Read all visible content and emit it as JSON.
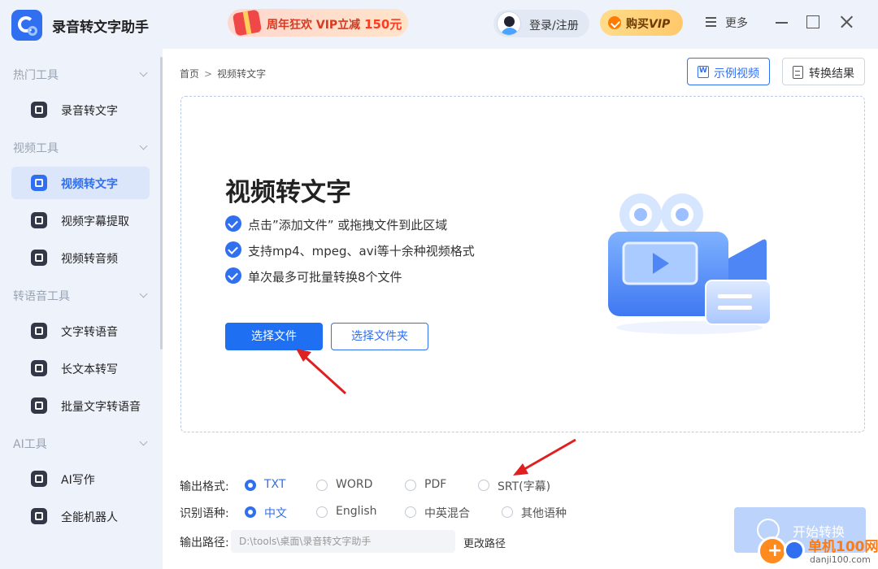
{
  "titlebar": {
    "app_name": "录音转文字助手",
    "promo_text": "周年狂欢 VIP立减 ",
    "promo_amount": "150元",
    "login_label": "登录/注册",
    "vip_prefix": "购买",
    "vip_suffix": "VIP",
    "more_label": "更多"
  },
  "sidebar": {
    "sections": [
      {
        "title": "热门工具",
        "items": [
          {
            "label": "录音转文字",
            "icon": "text-t-icon"
          }
        ]
      },
      {
        "title": "视频工具",
        "items": [
          {
            "label": "视频转文字",
            "icon": "video-text-icon",
            "active": true
          },
          {
            "label": "视频字幕提取",
            "icon": "subtitle-extract-icon"
          },
          {
            "label": "视频转音频",
            "icon": "video-audio-icon"
          }
        ]
      },
      {
        "title": "转语音工具",
        "items": [
          {
            "label": "文字转语音",
            "icon": "waveform-icon"
          },
          {
            "label": "长文本转写",
            "icon": "long-text-icon"
          },
          {
            "label": "批量文字转语音",
            "icon": "batch-audio-icon"
          }
        ]
      },
      {
        "title": "AI工具",
        "items": [
          {
            "label": "AI写作",
            "icon": "ai-write-icon"
          },
          {
            "label": "全能机器人",
            "icon": "robot-icon"
          }
        ]
      }
    ]
  },
  "main": {
    "breadcrumb": {
      "home": "首页",
      "separator": ">",
      "current": "视频转文字"
    },
    "example_button": "示例视频",
    "result_button": "转换结果",
    "dropzone": {
      "title": "视频转文字",
      "tips": [
        "点击”添加文件” 或拖拽文件到此区域",
        "支持mp4、mpeg、avi等十余种视频格式",
        "单次最多可批量转换8个文件"
      ],
      "select_file": "选择文件",
      "select_folder": "选择文件夹"
    },
    "settings": {
      "format_label": "输出格式:",
      "formats": [
        "TXT",
        "WORD",
        "PDF",
        "SRT(字幕)"
      ],
      "format_selected": "TXT",
      "language_label": "识别语种:",
      "languages": [
        "中文",
        "English",
        "中英混合",
        "其他语种"
      ],
      "language_selected": "中文",
      "path_label": "输出路径:",
      "path_value": "D:\\tools\\桌面\\录音转文字助手",
      "path_change": "更改路径"
    },
    "start_button": "开始转换"
  },
  "watermark": {
    "name": "单机100网",
    "url": "danji100.com"
  },
  "colors": {
    "accent": "#2f6ff0",
    "arrow": "#e02020",
    "promo": "#d83a20"
  }
}
